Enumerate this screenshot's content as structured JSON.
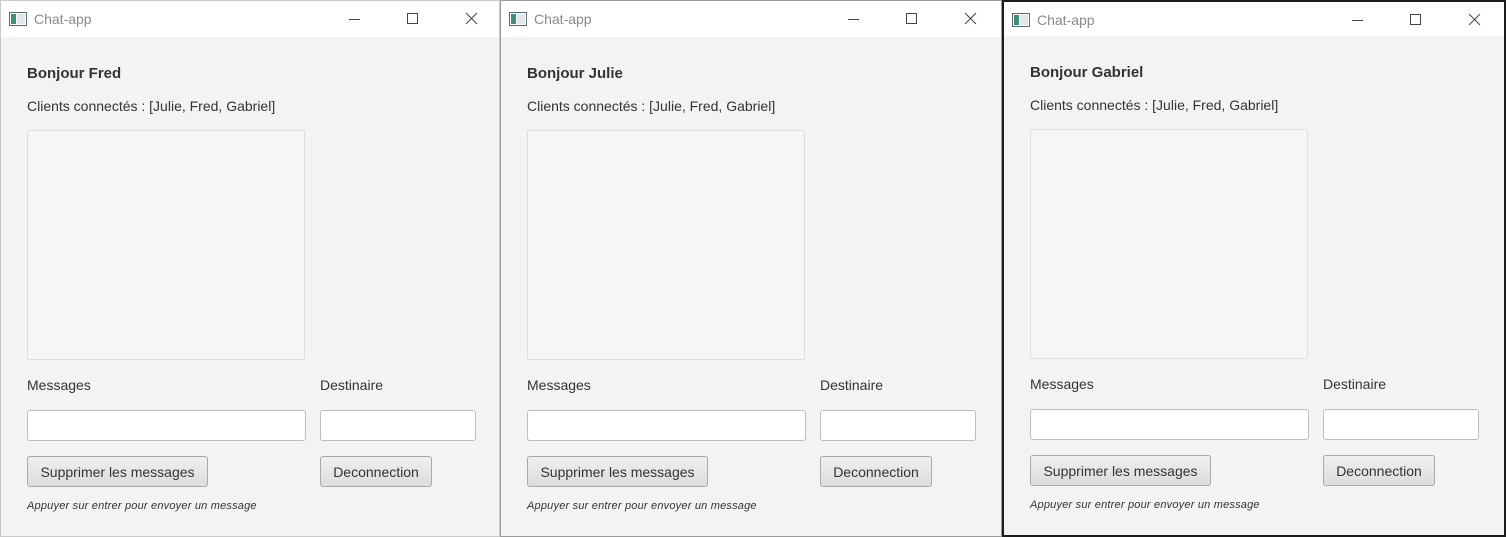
{
  "windows": [
    {
      "title": "Chat-app",
      "greeting": "Bonjour Fred",
      "clients": "Clients connectés : [Julie, Fred, Gabriel]",
      "messages_label": "Messages",
      "recipient_label": "Destinaire",
      "message_input_value": "",
      "recipient_input_value": "",
      "clear_button": "Supprimer les messages",
      "disconnect_button": "Deconnection",
      "hint": "Appuyer sur entrer pour envoyer un message"
    },
    {
      "title": "Chat-app",
      "greeting": "Bonjour Julie",
      "clients": "Clients connectés : [Julie, Fred, Gabriel]",
      "messages_label": "Messages",
      "recipient_label": "Destinaire",
      "message_input_value": "",
      "recipient_input_value": "",
      "clear_button": "Supprimer les messages",
      "disconnect_button": "Deconnection",
      "hint": "Appuyer sur entrer pour envoyer un message"
    },
    {
      "title": "Chat-app",
      "greeting": "Bonjour Gabriel",
      "clients": "Clients connectés : [Julie, Fred, Gabriel]",
      "messages_label": "Messages",
      "recipient_label": "Destinaire",
      "message_input_value": "",
      "recipient_input_value": "",
      "clear_button": "Supprimer les messages",
      "disconnect_button": "Deconnection",
      "hint": "Appuyer sur entrer pour envoyer un message"
    }
  ],
  "icons": {
    "app": "app-window-icon",
    "minimize": "minimize-icon",
    "maximize": "maximize-icon",
    "close": "close-icon"
  },
  "colors": {
    "window_bg": "#f3f3f3",
    "titlebar_bg": "#ffffff",
    "title_text": "#8a8a8a",
    "text": "#333333"
  }
}
